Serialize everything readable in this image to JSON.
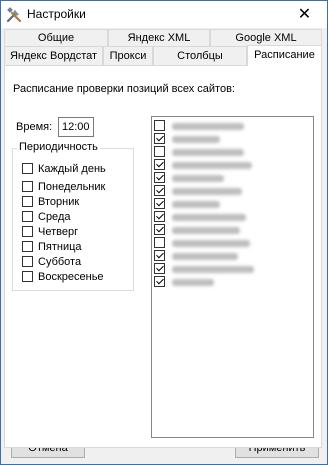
{
  "window": {
    "title": "Настройки",
    "icon": "tools-icon",
    "close_glyph": "✕"
  },
  "tabs_row1": [
    "Общие",
    "Яндекс XML",
    "Google XML"
  ],
  "tabs_row2": [
    "Яндекс Вордстат",
    "Прокси",
    "Столбцы",
    "Расписание"
  ],
  "active_tab": "Расписание",
  "schedule": {
    "heading": "Расписание проверки позиций всех сайтов:",
    "time_label": "Время:",
    "time_value": "12:00",
    "periodicity_title": "Периодичность",
    "days": [
      {
        "label": "Каждый день",
        "checked": false
      },
      {
        "label": "Понедельник",
        "checked": false
      },
      {
        "label": "Вторник",
        "checked": false
      },
      {
        "label": "Среда",
        "checked": false
      },
      {
        "label": "Четверг",
        "checked": false
      },
      {
        "label": "Пятница",
        "checked": false
      },
      {
        "label": "Суббота",
        "checked": false
      },
      {
        "label": "Воскресенье",
        "checked": false
      }
    ],
    "sites": [
      {
        "checked": false
      },
      {
        "checked": true
      },
      {
        "checked": false
      },
      {
        "checked": true
      },
      {
        "checked": true
      },
      {
        "checked": true
      },
      {
        "checked": true
      },
      {
        "checked": true
      },
      {
        "checked": true
      },
      {
        "checked": false
      },
      {
        "checked": true
      },
      {
        "checked": true
      },
      {
        "checked": true
      }
    ]
  },
  "buttons": {
    "cancel": "Отмена",
    "apply": "Применить"
  }
}
